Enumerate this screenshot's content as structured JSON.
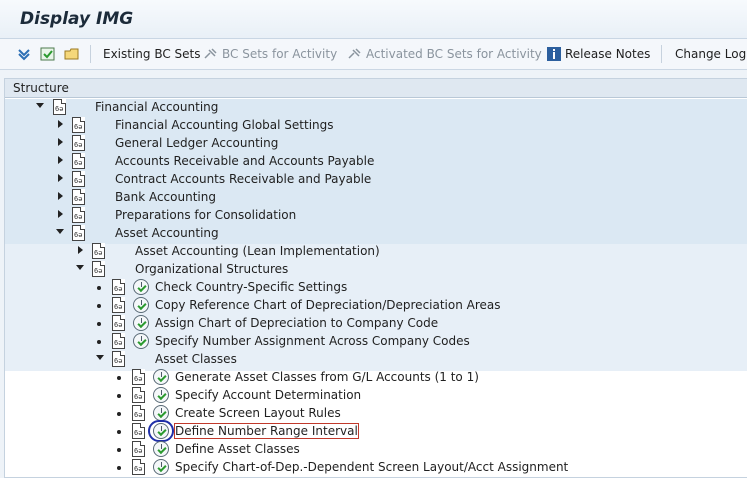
{
  "window": {
    "title": "Display IMG"
  },
  "toolbar": {
    "existing_bc_sets": "Existing BC Sets",
    "bc_sets_for_activity": "BC Sets for Activity",
    "activated_bc_sets_for_activity": "Activated BC Sets for Activity",
    "release_notes": "Release Notes",
    "change_log": "Change Log"
  },
  "tree": {
    "header": "Structure",
    "root": {
      "label": "Financial Accounting"
    },
    "level1": [
      "Financial Accounting Global Settings",
      "General Ledger Accounting",
      "Accounts Receivable and Accounts Payable",
      "Contract Accounts Receivable and Payable",
      "Bank Accounting",
      "Preparations for Consolidation",
      "Asset Accounting"
    ],
    "level2": [
      "Asset Accounting (Lean Implementation)",
      "Organizational Structures"
    ],
    "level3": [
      "Check Country-Specific Settings",
      "Copy Reference Chart of Depreciation/Depreciation Areas",
      "Assign Chart of Depreciation to Company Code",
      "Specify Number Assignment Across Company Codes",
      "Asset Classes"
    ],
    "level4": [
      "Generate Asset Classes from G/L Accounts (1 to 1)",
      "Specify Account Determination",
      "Create Screen Layout Rules",
      "Define Number Range Interval",
      "Define Asset Classes",
      "Specify Chart-of-Dep.-Dependent Screen Layout/Acct Assignment"
    ]
  },
  "icons": {
    "doc_glyph": "6ǝ",
    "expand_icon": "triangle-down",
    "collapse_icon": "triangle-right",
    "exec_icon": "execute-clock-check",
    "brand_color": "#2b9a2f"
  }
}
